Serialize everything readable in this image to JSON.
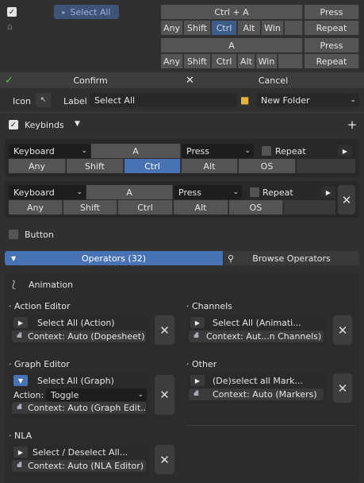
{
  "top": {
    "select_all_label": "Select All",
    "grid1": {
      "key": "Ctrl + A",
      "event": "Press",
      "mods": [
        "Any",
        "Shift",
        "Ctrl",
        "Alt",
        "Win"
      ],
      "action": "Repeat",
      "active_mod": "Ctrl"
    },
    "grid2": {
      "key": "A",
      "event": "Press",
      "mods": [
        "Any",
        "Shift",
        "Ctrl",
        "Alt",
        "Win"
      ],
      "action": "Repeat"
    }
  },
  "confirm_bar": {
    "confirm": "Confirm",
    "cancel": "Cancel"
  },
  "icon_row": {
    "icon_label": "Icon",
    "label_label": "Label",
    "label_value": "Select All",
    "folder_value": "New Folder"
  },
  "keybinds": {
    "title": "Keybinds",
    "bind1": {
      "device": "Keyboard",
      "key": "A",
      "event": "Press",
      "repeat": "Repeat",
      "mods": [
        "Any",
        "Shift",
        "Ctrl",
        "Alt",
        "OS"
      ],
      "active_mod": "Ctrl"
    },
    "bind2": {
      "device": "Keyboard",
      "key": "A",
      "event": "Press",
      "repeat": "Repeat",
      "mods": [
        "Any",
        "Shift",
        "Ctrl",
        "Alt",
        "OS"
      ]
    }
  },
  "button_label": "Button",
  "operators": {
    "tab_label": "Operators (32)",
    "browse_label": "Browse Operators",
    "category": "Animation",
    "groups": {
      "action_editor": {
        "title": "· Action Editor",
        "op": "Select All (Action)",
        "ctx": "Context: Auto (Dopesheet)"
      },
      "channels": {
        "title": "· Channels",
        "op": "Select All (Animati...",
        "ctx": "Context: Aut...n Channels)"
      },
      "graph_editor": {
        "title": "· Graph Editor",
        "op": "Select All (Graph)",
        "action_label": "Action:",
        "action_value": "Toggle",
        "ctx": "Context: Auto (Graph Edit..."
      },
      "other": {
        "title": "· Other",
        "op": "(De)select all Mark...",
        "ctx": "Context: Auto (Markers)"
      },
      "nla": {
        "title": "· NLA",
        "op": "Select / Deselect All...",
        "ctx": "Context: Auto (NLA Editor)"
      }
    }
  },
  "colors": {
    "accent": "#4772b3",
    "bg": "#303030",
    "confirm_check": "#5ec14a"
  }
}
